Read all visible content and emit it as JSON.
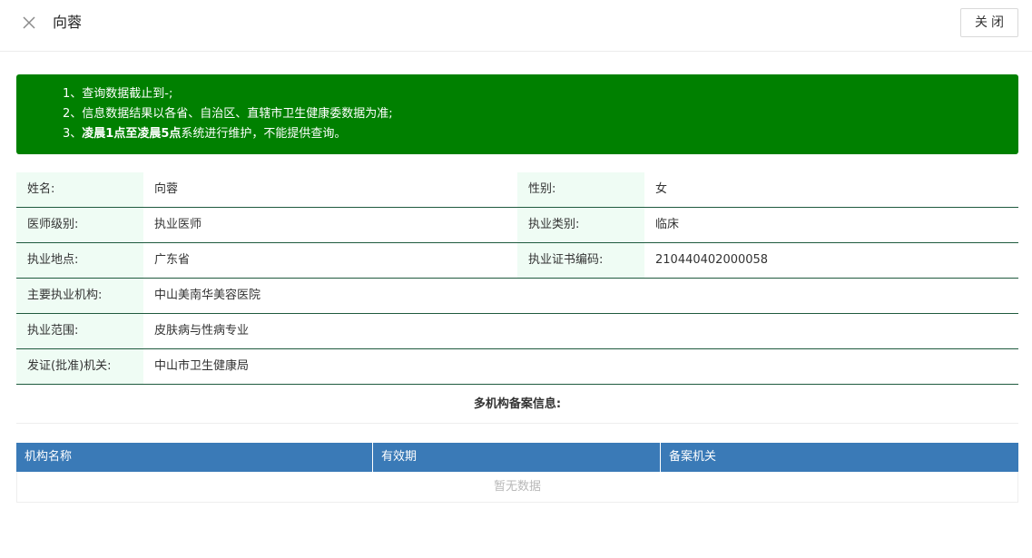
{
  "header": {
    "title": "向蓉",
    "close_button": "关闭"
  },
  "notice": {
    "line1": "1、查询数据截止到-;",
    "line2": "2、信息数据结果以各省、自治区、直辖市卫生健康委数据为准;",
    "line3_prefix": "3、",
    "line3_bold": "凌晨1点至凌晨5点",
    "line3_suffix": "系统进行维护，不能提供查询。"
  },
  "info": {
    "name_label": "姓名:",
    "name_value": "向蓉",
    "gender_label": "性别:",
    "gender_value": "女",
    "level_label": "医师级别:",
    "level_value": "执业医师",
    "category_label": "执业类别:",
    "category_value": "临床",
    "location_label": "执业地点:",
    "location_value": "广东省",
    "cert_label": "执业证书编码:",
    "cert_value": "210440402000058",
    "org_label": "主要执业机构:",
    "org_value": "中山美南华美容医院",
    "scope_label": "执业范围:",
    "scope_value": "皮肤病与性病专业",
    "issuer_label": "发证(批准)机关:",
    "issuer_value": "中山市卫生健康局"
  },
  "multi_org": {
    "title": "多机构备案信息:",
    "columns": [
      "机构名称",
      "有效期",
      "备案机关"
    ],
    "empty_text": "暂无数据"
  },
  "colors": {
    "notice_bg": "#008000",
    "label_bg": "#effcf4",
    "row_border": "#1f5a3e",
    "table_header_bg": "#3a7ab7"
  }
}
